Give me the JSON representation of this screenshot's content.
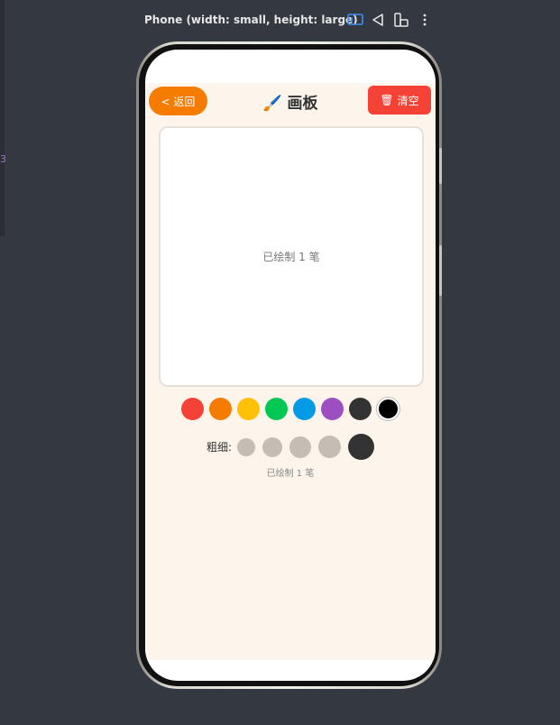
{
  "device_bar": {
    "title": "Phone (width: small, height: large)",
    "icons": [
      "tablet-layout-icon",
      "rotate-icon",
      "fold-layout-icon",
      "more-vertical-icon"
    ]
  },
  "app": {
    "back_label": "< 返回",
    "title_icon": "🖌️",
    "title": "画板",
    "clear_icon": "🗑",
    "clear_label": "清空",
    "canvas_status": "已绘制 1 笔",
    "palette": [
      "#f44336",
      "#f57c00",
      "#ffc107",
      "#00c853",
      "#039be5",
      "#9c4fc1",
      "#333333",
      "#000000"
    ],
    "selected_color": "#000000",
    "thickness_label": "粗细:",
    "thickness_options": [
      "thin",
      "medium-thin",
      "medium",
      "thick",
      "extra-thick"
    ],
    "selected_thickness": "extra-thick",
    "bottom_status": "已绘制 1 笔"
  },
  "colors": {
    "background": "#343841",
    "app_background": "#fdf5ec",
    "back_button": "#f57c00",
    "clear_button": "#f44336",
    "accent_icon": "#3d8ef0"
  }
}
